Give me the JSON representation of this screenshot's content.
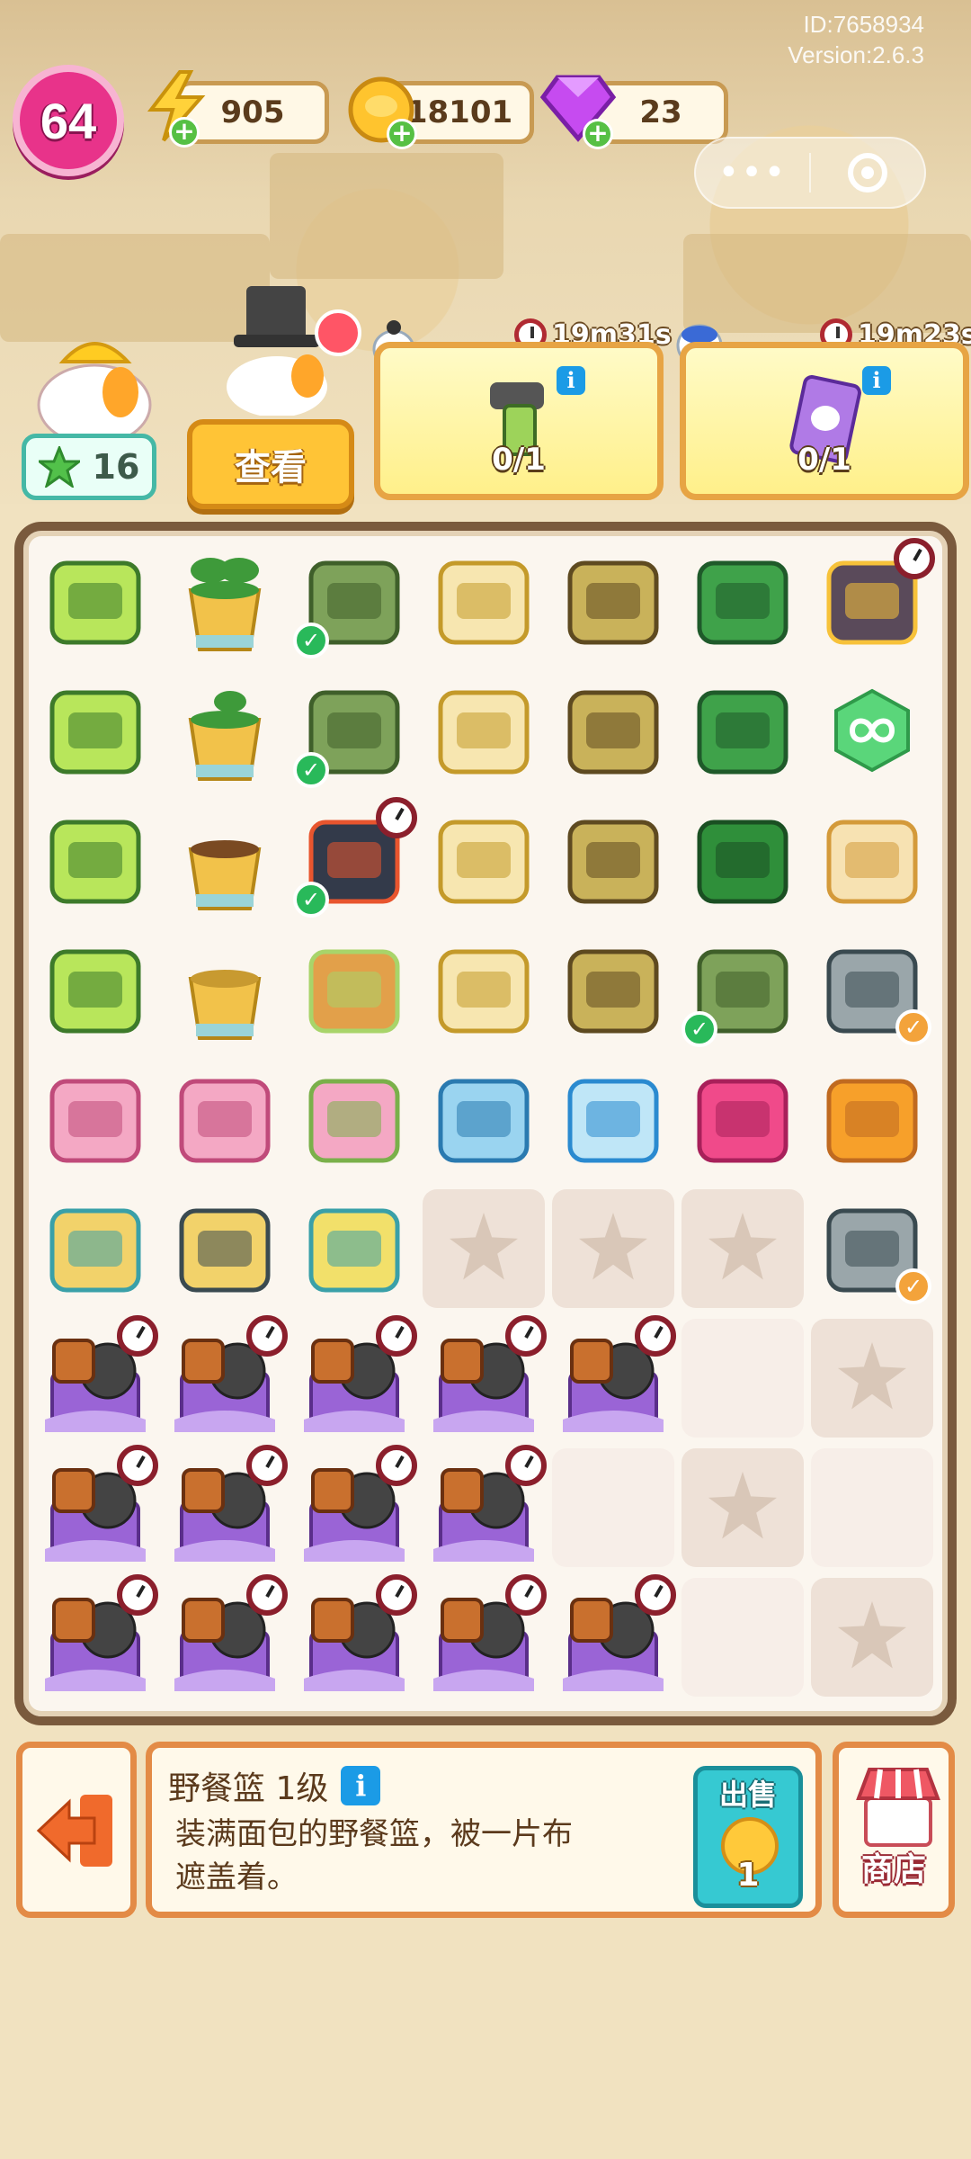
{
  "meta": {
    "id_text": "ID:7658934",
    "version_text": "Version:2.6.3"
  },
  "player": {
    "level": "64"
  },
  "resources": {
    "energy": "905",
    "coins": "18101",
    "gems": "23"
  },
  "stars": {
    "count": "16"
  },
  "view_button": {
    "label": "查看"
  },
  "orders": [
    {
      "timer": "19m31s",
      "progress": "0/1",
      "item_icon": "drill-icon"
    },
    {
      "timer": "19m23s",
      "progress": "0/1",
      "item_icon": "card-icon"
    }
  ],
  "board": {
    "items": [
      [
        "laptop",
        "plant-pot",
        "gloves",
        "duck-cart",
        "cabinet",
        "toolbox-green",
        "magic-hat"
      ],
      [
        "laptop",
        "plant-pot-sprout",
        "gloves",
        "duck-cart",
        "cabinet",
        "toolbox-open",
        "infinity-gem"
      ],
      [
        "laptop",
        "plant-pot-seed",
        "game-console",
        "duck-cart",
        "cabinet",
        "tackle-box",
        "bread-loaf"
      ],
      [
        "laptop",
        "empty-pot",
        "picnic-basket",
        "duck-cart",
        "cabinet",
        "gloves",
        "spring-grip"
      ],
      [
        "pink-fridge",
        "pink-fridge-small",
        "pink-fridge-open",
        "water-dispenser",
        "robot-vacuum",
        "pink-backpack",
        "flower-basket"
      ],
      [
        "cart-boxes",
        "cart-bin",
        "basket-dumbbell",
        "empty",
        "empty",
        "empty",
        "hand-grip"
      ],
      [
        "gift-box",
        "gift-box",
        "gift-box",
        "gift-box",
        "gift-box",
        "blank",
        "empty"
      ],
      [
        "gift-box",
        "gift-box",
        "gift-box",
        "gift-box",
        "blank",
        "empty",
        "blank"
      ],
      [
        "gift-box",
        "gift-box",
        "gift-box",
        "gift-box",
        "gift-box",
        "blank",
        "empty"
      ]
    ]
  },
  "info_panel": {
    "title": "野餐篮 1级",
    "description": "装满面包的野餐篮，被一片布遮盖着。"
  },
  "sell": {
    "label": "出售",
    "price": "1"
  },
  "shop": {
    "label": "商店"
  },
  "colors": {
    "accent_orange": "#e38b46",
    "level_pink": "#e8338a",
    "stars_teal": "#45b8a6",
    "sell_cyan": "#36c9d2",
    "board_border": "#7a5a3d"
  }
}
